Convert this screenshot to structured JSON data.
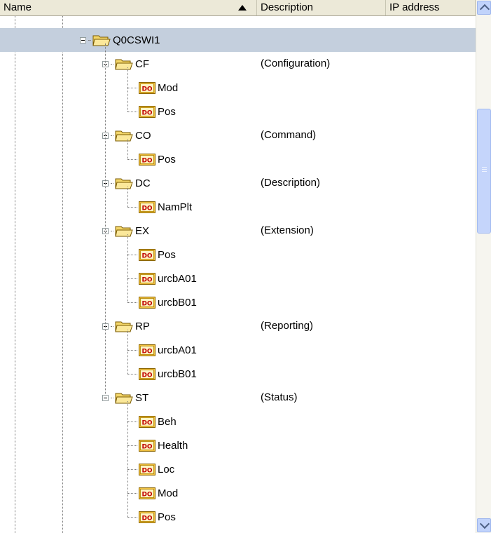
{
  "header": {
    "name": "Name",
    "description": "Description",
    "ip_address": "IP address"
  },
  "tree": {
    "root": {
      "label": "Q0CSWI1",
      "icon": "folder-open-icon",
      "selected": true
    },
    "groups": [
      {
        "label": "CF",
        "description": "(Configuration)",
        "children": [
          "Mod",
          "Pos"
        ]
      },
      {
        "label": "CO",
        "description": "(Command)",
        "children": [
          "Pos"
        ]
      },
      {
        "label": "DC",
        "description": "(Description)",
        "children": [
          "NamPlt"
        ]
      },
      {
        "label": "EX",
        "description": "(Extension)",
        "children": [
          "Pos",
          "urcbA01",
          "urcbB01"
        ]
      },
      {
        "label": "RP",
        "description": "(Reporting)",
        "children": [
          "urcbA01",
          "urcbB01"
        ]
      },
      {
        "label": "ST",
        "description": "(Status)",
        "children": [
          "Beh",
          "Health",
          "Loc",
          "Mod",
          "Pos"
        ]
      }
    ],
    "child_icon_text": "DO"
  },
  "colors": {
    "selection": "#c4cfdd",
    "folder": "#f4d76a",
    "do_icon": "#f0c040",
    "do_text": "#c00000",
    "scroll_thumb": "#c5d5fb"
  }
}
